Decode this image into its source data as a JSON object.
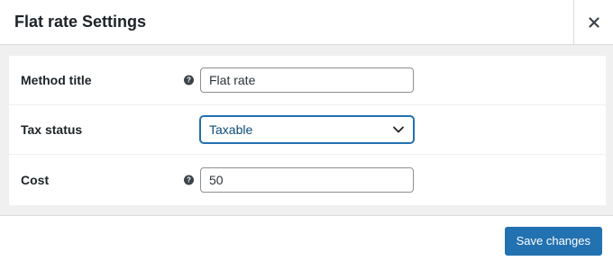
{
  "modal": {
    "title": "Flat rate Settings",
    "close_icon": "close-icon"
  },
  "form": {
    "rows": [
      {
        "label": "Method title",
        "help_icon": "question-circle-icon",
        "input_value": "Flat rate"
      },
      {
        "label": "Tax status",
        "select_value": "Taxable",
        "select_icon": "chevron-down-icon"
      },
      {
        "label": "Cost",
        "help_icon": "question-circle-icon",
        "input_value": "50"
      }
    ]
  },
  "footer": {
    "save_label": "Save changes"
  },
  "colors": {
    "accent": "#2271b1",
    "body_background": "#f0f0f1",
    "border": "#dcdcde",
    "text": "#1d2327"
  }
}
